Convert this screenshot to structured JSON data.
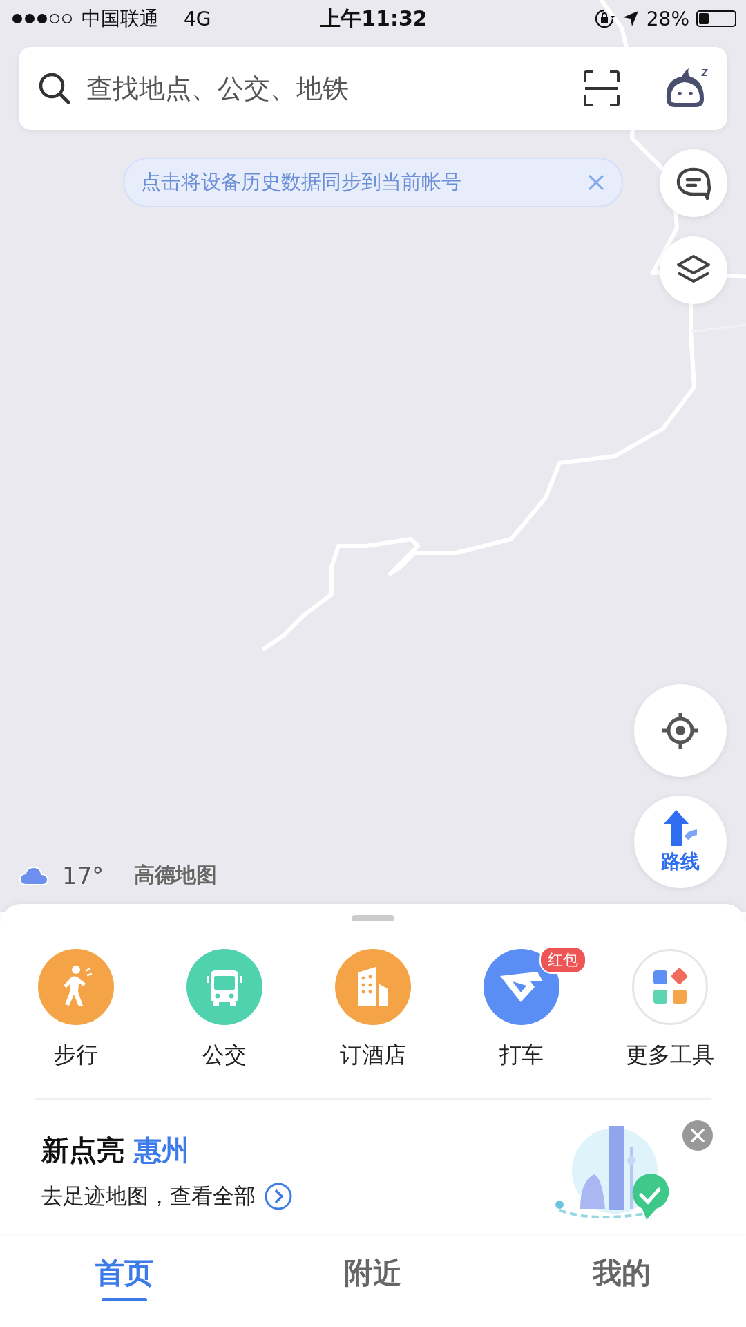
{
  "status_bar": {
    "carrier": "中国联通",
    "network": "4G",
    "time": "上午11:32",
    "battery": "28%"
  },
  "search": {
    "placeholder": "查找地点、公交、地铁"
  },
  "sync_banner": {
    "text": "点击将设备历史数据同步到当前帐号"
  },
  "weather": {
    "temperature": "17°"
  },
  "map_logo": "高德地图",
  "route_button": {
    "label": "路线"
  },
  "tools": [
    {
      "kind": "walk",
      "label": "步行",
      "color": "#f5a347"
    },
    {
      "kind": "bus",
      "label": "公交",
      "color": "#4fd2ad"
    },
    {
      "kind": "hotel",
      "label": "订酒店",
      "color": "#f5a347"
    },
    {
      "kind": "taxi",
      "label": "打车",
      "color": "#5b8ef5",
      "badge": "红包"
    },
    {
      "kind": "more",
      "label": "更多工具",
      "color": "#ffffff"
    }
  ],
  "footprint_card": {
    "title": "新点亮",
    "city": "惠州",
    "subtitle": "去足迹地图，查看全部"
  },
  "tabs": [
    {
      "label": "首页",
      "selected": true
    },
    {
      "label": "附近",
      "selected": false
    },
    {
      "label": "我的",
      "selected": false
    }
  ]
}
